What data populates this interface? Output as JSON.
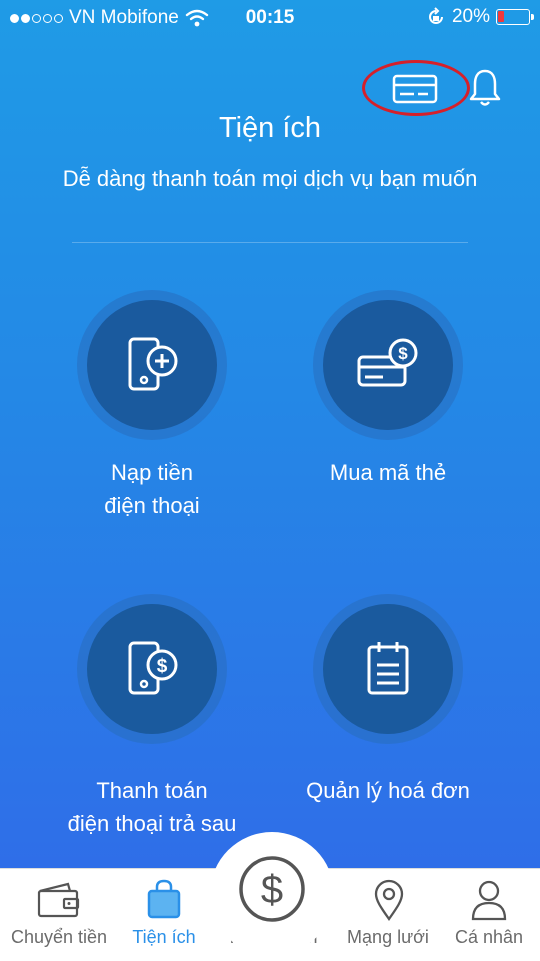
{
  "status_bar": {
    "carrier": "VN Mobifone",
    "time": "00:15",
    "battery_percent": "20%",
    "battery_level": 0.2,
    "signal_filled": 2,
    "signal_total": 5
  },
  "header": {
    "title": "Tiện ích",
    "subtitle": "Dễ dàng thanh toán mọi dịch vụ bạn muốn"
  },
  "tiles": [
    {
      "id": "phone-topup",
      "line1": "Nạp tiền",
      "line2": "điện thoại",
      "icon": "phone-plus-icon"
    },
    {
      "id": "buy-card-code",
      "line1": "Mua mã thẻ",
      "line2": "",
      "icon": "card-dollar-icon"
    },
    {
      "id": "postpaid-payment",
      "line1": "Thanh toán",
      "line2": "điện thoại trả sau",
      "icon": "phone-dollar-icon"
    },
    {
      "id": "bill-management",
      "line1": "Quản lý hoá đơn",
      "line2": "",
      "icon": "clipboard-icon"
    }
  ],
  "tab_bar": {
    "tabs": [
      {
        "label": "Chuyển tiền",
        "icon": "wallet-icon"
      },
      {
        "label": "Tiện ích",
        "icon": "shopping-bag-icon",
        "active": true
      },
      {
        "label": "Thanh toán",
        "icon": "dollar-circle-icon"
      },
      {
        "label": "Mạng lưới",
        "icon": "map-pin-icon"
      },
      {
        "label": "Cá nhân",
        "icon": "user-icon"
      }
    ]
  },
  "colors": {
    "accent": "#2a90e8",
    "highlight_ring": "#d5202a",
    "tile_circle": "#1a5a9e",
    "battery_low": "#f0393c"
  }
}
